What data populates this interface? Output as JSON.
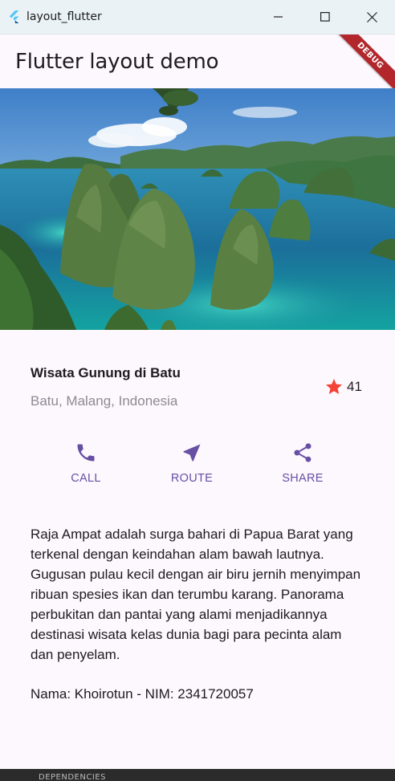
{
  "window": {
    "title": "layout_flutter",
    "controls": [
      "minimize-icon",
      "maximize-icon",
      "close-icon"
    ]
  },
  "appbar": {
    "title": "Flutter layout demo",
    "debug_banner": "DEBUG"
  },
  "hero_image": {
    "icon": "landscape-photo"
  },
  "title_section": {
    "name": "Wisata Gunung di Batu",
    "location": "Batu, Malang, Indonesia",
    "rating": "41",
    "rating_icon": "star-icon"
  },
  "buttons": [
    {
      "label": "CALL",
      "icon": "phone-icon"
    },
    {
      "label": "ROUTE",
      "icon": "navigation-icon"
    },
    {
      "label": "SHARE",
      "icon": "share-icon"
    }
  ],
  "description": "Raja Ampat adalah surga bahari di Papua Barat yang terkenal dengan keindahan alam bawah lautnya. Gugusan pulau kecil dengan air biru jernih menyimpan ribuan spesies ikan dan terumbu karang. Panorama perbukitan dan pantai yang alami menjadikannya destinasi wisata kelas dunia bagi para pecinta alam dan penyelam.",
  "footer": "Nama: Khoirotun - NIM: 2341720057",
  "bottom_strip": "DEPENDENCIES",
  "colors": {
    "accent": "#6750a4",
    "star": "#f44336",
    "background": "#fdf7fe",
    "debug": "#b2272c"
  }
}
